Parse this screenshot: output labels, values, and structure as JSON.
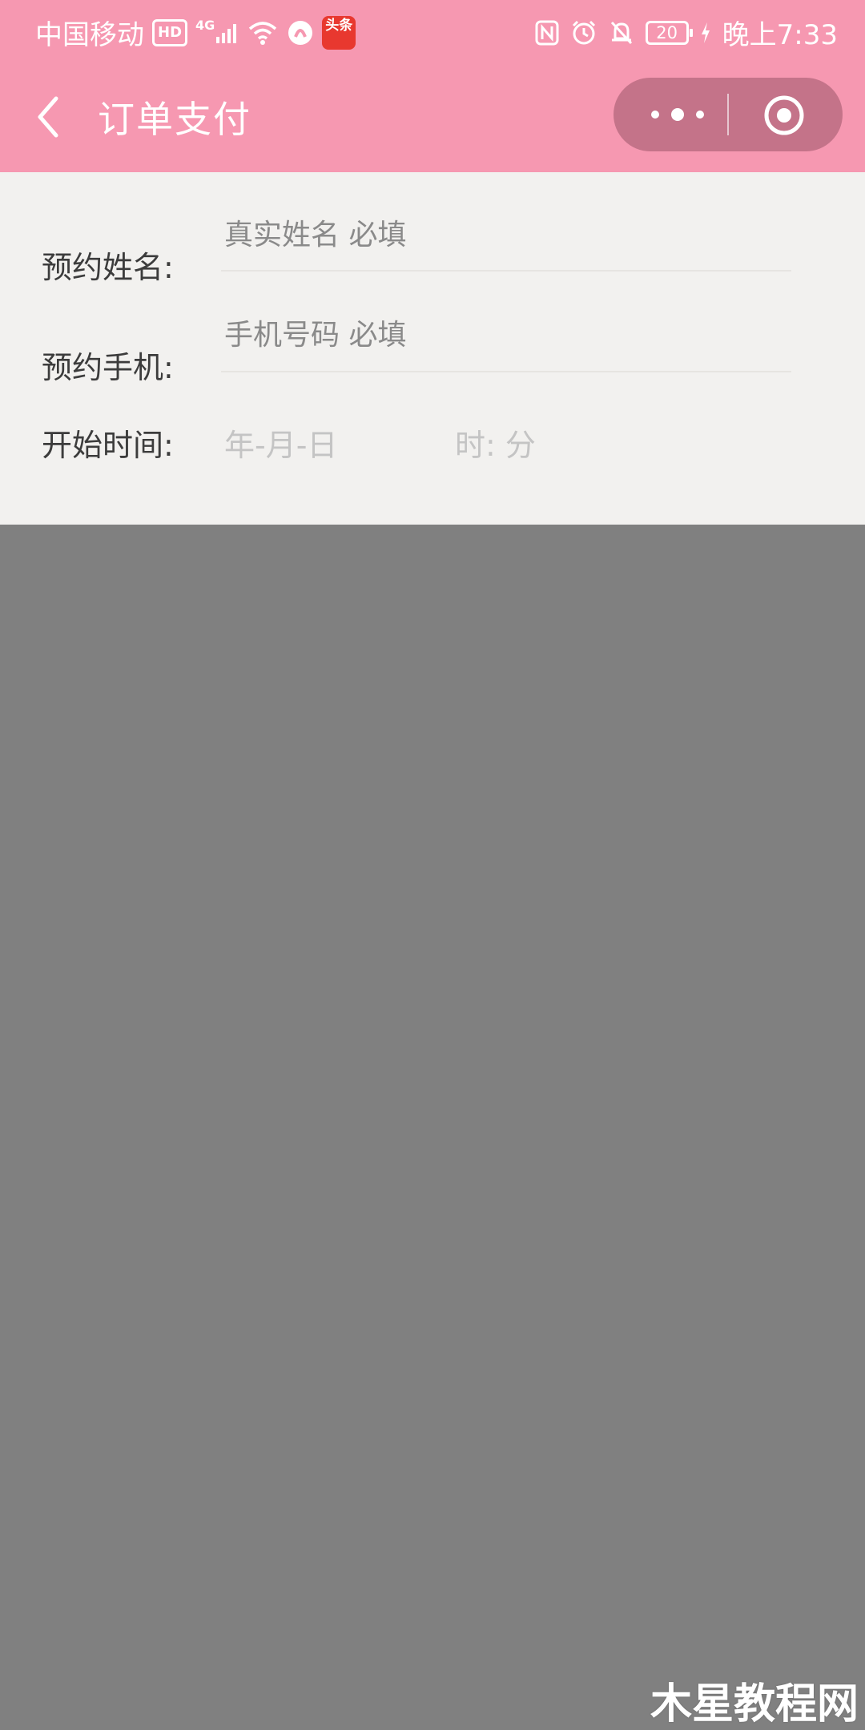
{
  "status_bar": {
    "carrier": "中国移动",
    "hd": "HD",
    "network": "4G",
    "app_badge": "头条",
    "battery": "20",
    "time": "晚上7:33"
  },
  "nav": {
    "title": "订单支付",
    "back_icon": "chevron-left-icon",
    "more_icon": "more-dots-icon",
    "close_icon": "target-close-icon"
  },
  "form": {
    "name": {
      "label": "预约姓名:",
      "placeholder": "真实姓名 必填",
      "value": ""
    },
    "phone": {
      "label": "预约手机:",
      "placeholder": "手机号码 必填",
      "value": ""
    },
    "start_time": {
      "label": "开始时间:",
      "date_placeholder": "年-月-日",
      "time_placeholder": "时: 分"
    }
  },
  "watermark": "木星教程网",
  "colors": {
    "nav_bg": "#f698b1",
    "capsule_bg": "#c47389",
    "form_bg": "#f2f1ef",
    "overlay": "#808080"
  }
}
